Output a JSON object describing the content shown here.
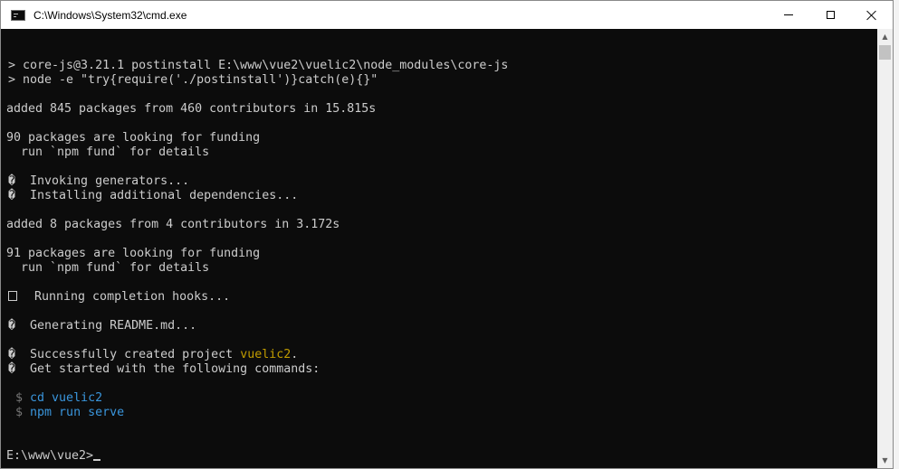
{
  "window": {
    "title": "C:\\Windows\\System32\\cmd.exe",
    "icon": "console-icon",
    "controls": [
      "minimize-icon",
      "maximize-icon",
      "close-icon"
    ]
  },
  "console": {
    "lines": [
      "> core-js@3.21.1 postinstall E:\\www\\vue2\\vuelic2\\node_modules\\core-js",
      "> node -e \"try{require('./postinstall')}catch(e){}\"",
      "",
      "added 845 packages from 460 contributors in 15.815s",
      "",
      "90 packages are looking for funding",
      "  run `npm fund` for details",
      "",
      "�  Invoking generators...",
      "�  Installing additional dependencies...",
      "",
      "added 8 packages from 4 contributors in 3.172s",
      "",
      "91 packages are looking for funding",
      "  run `npm fund` for details",
      "",
      "  Running completion hooks...",
      "",
      "�  Generating README.md...",
      "",
      "�  Successfully created project ",
      "�  Get started with the following commands:",
      "",
      " $ ",
      " $ ",
      "",
      "",
      "E:\\www\\vue2>"
    ],
    "project_name": "vuelic2",
    "period": ".",
    "cmd_cd": "cd vuelic2",
    "cmd_serve": "npm run serve",
    "colors": {
      "background": "#0c0c0c",
      "text": "#cccccc",
      "highlight_yellow": "#c19c00",
      "highlight_blue": "#3a96dd"
    }
  }
}
